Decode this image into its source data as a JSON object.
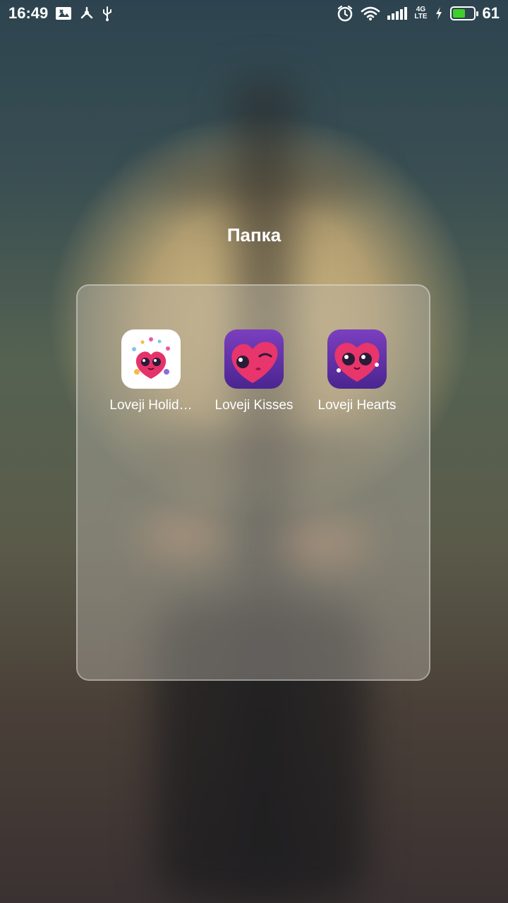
{
  "status_bar": {
    "time": "16:49",
    "left_icons": [
      "image-notification-icon",
      "share-icon",
      "usb-icon"
    ],
    "right_icons": [
      "alarm-icon",
      "wifi-icon",
      "signal-icon",
      "lte-icon",
      "charging-icon",
      "battery-icon"
    ],
    "network_top": "4G",
    "network_bottom": "LTE",
    "battery_percent": "61",
    "battery_level": 0.61,
    "battery_color": "#3fcf2b"
  },
  "folder": {
    "title": "Папка",
    "apps": [
      {
        "label": "Loveji Holid…",
        "icon": "loveji-holidays-icon"
      },
      {
        "label": "Loveji Kisses",
        "icon": "loveji-kisses-icon"
      },
      {
        "label": "Loveji Hearts",
        "icon": "loveji-hearts-icon"
      }
    ]
  }
}
